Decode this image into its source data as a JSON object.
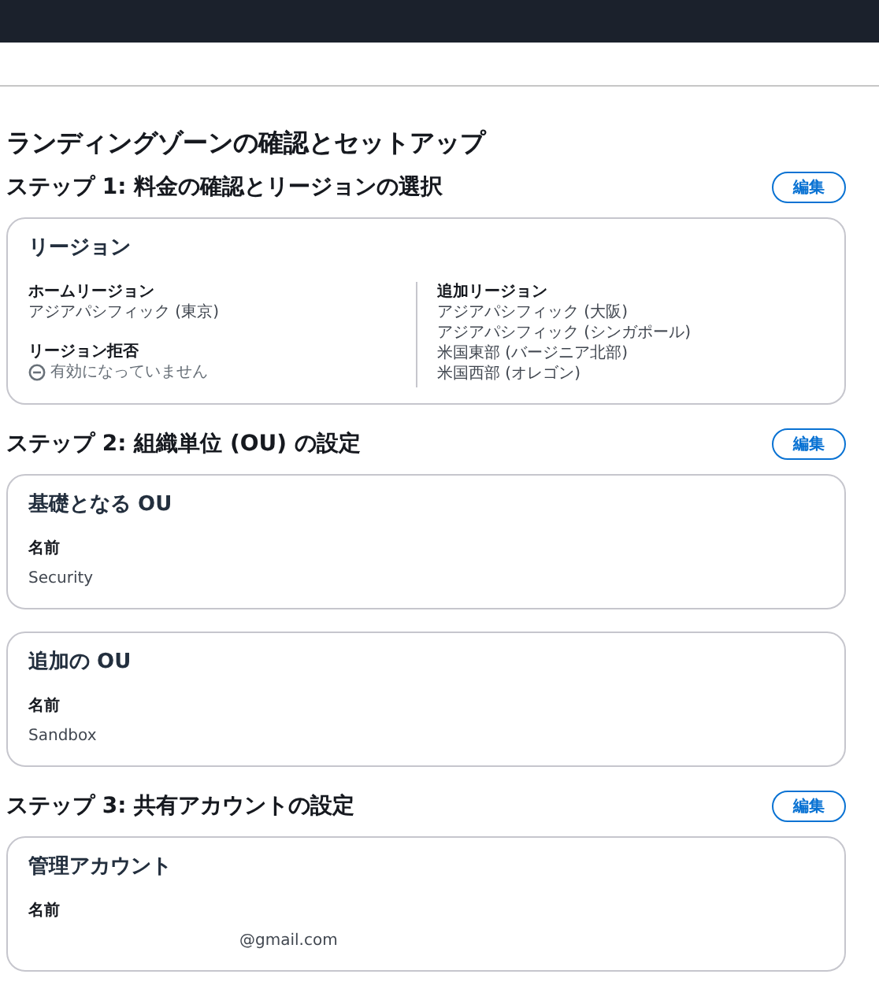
{
  "page_title": "ランディングゾーンの確認とセットアップ",
  "steps": [
    {
      "heading": "ステップ 1: 料金の確認とリージョンの選択",
      "edit_button": "編集",
      "cards": [
        {
          "kind": "columns",
          "title": "リージョン",
          "columns": [
            {
              "fields": [
                {
                  "label": "ホームリージョン",
                  "values": [
                    {
                      "kind": "plain",
                      "text": "アジアパシフィック (東京)"
                    }
                  ]
                },
                {
                  "label": "リージョン拒否",
                  "values": [
                    {
                      "kind": "status",
                      "text": "有効になっていません"
                    }
                  ]
                }
              ]
            },
            {
              "fields": [
                {
                  "label": "追加リージョン",
                  "values": [
                    {
                      "kind": "plain",
                      "text": "アジアパシフィック (大阪)"
                    },
                    {
                      "kind": "plain",
                      "text": "アジアパシフィック (シンガポール)"
                    },
                    {
                      "kind": "plain",
                      "text": "米国東部 (バージニア北部)"
                    },
                    {
                      "kind": "plain",
                      "text": "米国西部 (オレゴン)"
                    }
                  ]
                }
              ]
            }
          ]
        }
      ]
    },
    {
      "heading": "ステップ 2: 組織単位 (OU) の設定",
      "edit_button": "編集",
      "cards": [
        {
          "kind": "simple",
          "title": "基礎となる OU",
          "fields": [
            {
              "label": "名前",
              "value": "Security"
            }
          ]
        },
        {
          "kind": "simple",
          "title": "追加の OU",
          "fields": [
            {
              "label": "名前",
              "value": "Sandbox"
            }
          ]
        }
      ]
    },
    {
      "heading": "ステップ 3: 共有アカウントの設定",
      "edit_button": "編集",
      "cards": [
        {
          "kind": "account",
          "title": "管理アカウント",
          "fields": [
            {
              "label": "名前",
              "value": "@gmail.com"
            }
          ]
        }
      ]
    }
  ]
}
